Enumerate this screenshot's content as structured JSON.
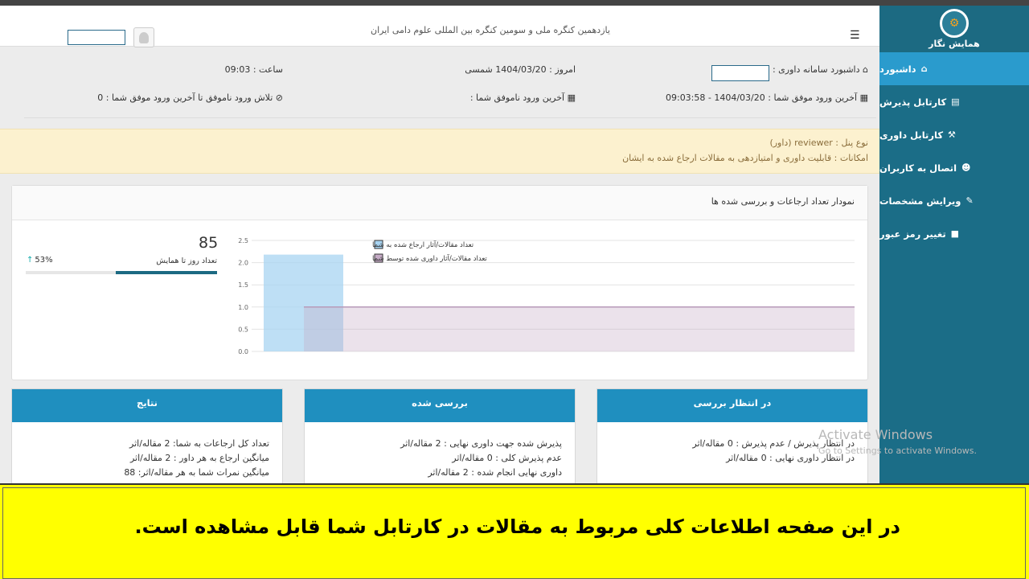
{
  "header": {
    "conference_title": "یازدهمین کنگره ملی و سومین کنگره بین المللی علوم دامی ایران",
    "menu_icon": "hamburger-icon",
    "avatar_icon": "user-avatar-icon"
  },
  "sidebar": {
    "logo_text": "همایش نگار",
    "items": [
      {
        "label": "داشبورد",
        "icon": "home-icon",
        "active": true
      },
      {
        "label": "کارتابل پذیرش",
        "icon": "file-icon",
        "active": false
      },
      {
        "label": "کارتابل داوری",
        "icon": "gavel-icon",
        "active": false
      },
      {
        "label": "اتصال به کاربران",
        "icon": "users-icon",
        "active": false
      },
      {
        "label": "ویرایش مشخصات",
        "icon": "edit-icon",
        "active": false
      },
      {
        "label": "تغییر رمز عبور",
        "icon": "lock-icon",
        "active": false
      }
    ]
  },
  "info": {
    "dashboard_label": "داشبورد سامانه داوری :",
    "today_label": "امروز : 1404/03/20 شمسی",
    "time_label": "ساعت : 09:03",
    "last_success": "آخرین ورود موفق شما : 1404/03/20 - 09:03:58",
    "last_failed": "آخرین ورود ناموفق شما :",
    "failed_attempts": "تلاش ورود ناموفق تا آخرین ورود موفق شما : 0"
  },
  "notice": {
    "panel_type": "نوع پنل : reviewer (داور)",
    "capabilities": "امکانات : قابلیت داوری و امتیازدهی به مقالات ارجاع شده به ایشان"
  },
  "chart_card": {
    "title": "نمودار تعداد ارجاعات و بررسی شده ها",
    "stat_value": "85",
    "stat_label": "تعداد روز تا همایش",
    "stat_percent": "53%",
    "progress_fraction": 0.53
  },
  "chart_data": {
    "type": "area",
    "y_ticks": [
      "0.0",
      "0.5",
      "1.0",
      "1.5",
      "2.0",
      "2.5"
    ],
    "ylim": [
      0,
      2.5
    ],
    "x_count": 3,
    "series": [
      {
        "name": "تعداد مقالات/آثار ارجاع شده به شما",
        "values": [
          2,
          2,
          2
        ],
        "color": "#a8d4f2"
      },
      {
        "name": "تعداد مقالات/آثار داوری شده توسط شما",
        "values": [
          1,
          1,
          1
        ],
        "color": "#c5abc6"
      }
    ],
    "legend": "top-left",
    "grid": true
  },
  "panels": [
    {
      "title": "نتایج",
      "rows": [
        "تعداد کل ارجاعات به شما: 2 مقاله/اثر",
        "میانگین ارجاع به هر داور : 2 مقاله/اثر",
        "میانگین نمرات شما به هر مقاله/اثر: 88"
      ]
    },
    {
      "title": "بررسی شده",
      "rows": [
        "پذیرش شده جهت داوری نهایی : 2 مقاله/اثر",
        "عدم پذیرش کلی : 0 مقاله/اثر",
        "داوری نهایی انجام شده : 2 مقاله/اثر"
      ]
    },
    {
      "title": "در انتظار بررسی",
      "rows": [
        "در انتظار پذیرش / عدم پذیرش : 0 مقاله/اثر",
        "در انتظار داوری نهایی : 0 مقاله/اثر"
      ]
    }
  ],
  "watermark": {
    "title": "Activate Windows",
    "subtitle": "Go to Settings to activate Windows."
  },
  "caption": {
    "text": "در این صفحه اطلاعات کلی مربوط به مقالات در کارتابل شما قابل مشاهده است."
  }
}
